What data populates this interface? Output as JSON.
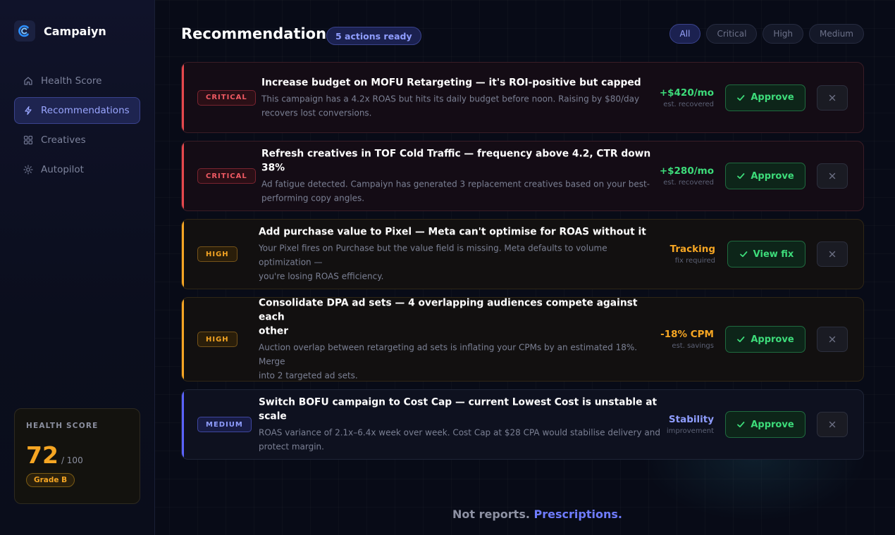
{
  "app": {
    "name": "Campaiyn"
  },
  "sidebar": {
    "nav": [
      {
        "label": "Health Score",
        "icon": "home-icon",
        "active": false
      },
      {
        "label": "Recommendations",
        "icon": "lightning-icon",
        "active": true
      },
      {
        "label": "Creatives",
        "icon": "grid-icon",
        "active": false
      },
      {
        "label": "Autopilot",
        "icon": "sun-gear-icon",
        "active": false
      }
    ],
    "health": {
      "label": "HEALTH SCORE",
      "value": "72",
      "max": "/ 100",
      "grade": "Grade B"
    }
  },
  "header": {
    "title": "Recommendations",
    "badge": "5 actions ready",
    "filters": [
      {
        "label": "All",
        "active": true
      },
      {
        "label": "Critical",
        "active": false
      },
      {
        "label": "High",
        "active": false
      },
      {
        "label": "Medium",
        "active": false
      }
    ]
  },
  "recommendations": [
    {
      "severity": "CRITICAL",
      "title": "Increase budget on MOFU Retargeting — it's ROI-positive but capped",
      "desc_lines": [
        "This campaign has a 4.2x ROAS but hits its daily budget before noon. Raising by $80/day",
        "recovers lost conversions."
      ],
      "impact": "+$420/mo",
      "impact_sub": "est. recovered",
      "action": "Approve"
    },
    {
      "severity": "CRITICAL",
      "title": "Refresh creatives in TOF Cold Traffic — frequency above 4.2, CTR down 38%",
      "desc_lines": [
        "Ad fatigue detected. Campaiyn has generated 3 replacement creatives based on your best-",
        "performing copy angles."
      ],
      "impact": "+$280/mo",
      "impact_sub": "est. recovered",
      "action": "Approve"
    },
    {
      "severity": "HIGH",
      "title": "Add purchase value to Pixel — Meta can't optimise for ROAS without it",
      "desc_lines": [
        "Your Pixel fires on Purchase but the value field is missing. Meta defaults to volume optimization —",
        "you're losing ROAS efficiency."
      ],
      "impact": "Tracking",
      "impact_sub": "fix required",
      "action": "View fix"
    },
    {
      "severity": "HIGH",
      "title_lines": [
        "Consolidate DPA ad sets — 4 overlapping audiences compete against each",
        "other"
      ],
      "desc_lines": [
        "Auction overlap between retargeting ad sets is inflating your CPMs by an estimated 18%. Merge",
        "into 2 targeted ad sets."
      ],
      "impact": "-18% CPM",
      "impact_sub": "est. savings",
      "action": "Approve"
    },
    {
      "severity": "MEDIUM",
      "title": "Switch BOFU campaign to Cost Cap — current Lowest Cost is unstable at scale",
      "desc_lines": [
        "ROAS variance of 2.1x–6.4x week over week. Cost Cap at $28 CPA would stabilise delivery and",
        "protect margin."
      ],
      "impact": "Stability",
      "impact_sub": "improvement",
      "action": "Approve"
    }
  ],
  "footer": {
    "text": "Not reports.",
    "highlight": "Prescriptions."
  },
  "colors": {
    "critical": "#e5484d",
    "high": "#f5a524",
    "medium": "#5b63ff",
    "approve_green": "#3ddc7a",
    "impact_green": "#3ddc7a",
    "impact_orange": "#f6a623",
    "impact_purple": "#8f9dff"
  }
}
